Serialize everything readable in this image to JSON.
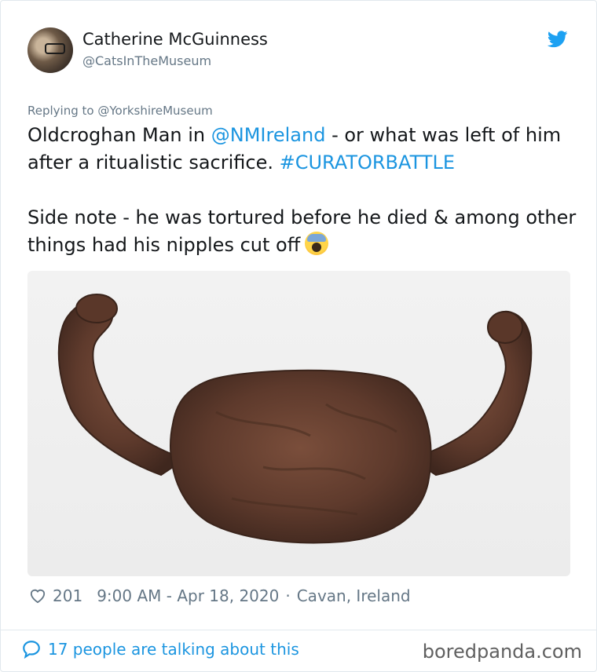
{
  "user": {
    "display_name": "Catherine McGuinness",
    "handle": "@CatsInTheMuseum"
  },
  "reply": {
    "prefix": "Replying to ",
    "target": "@YorkshireMuseum"
  },
  "tweet": {
    "line1_a": "Oldcroghan Man in ",
    "mention": "@NMIreland",
    "line1_b": " - or what was left of him after a ritualistic sacrifice. ",
    "hashtag": "#CURATORBATTLE",
    "line2": "Side note - he was tortured before he died & among other things had his nipples cut off"
  },
  "icons": {
    "bird": "twitter-bird-icon",
    "emoji": "screaming-face-emoji",
    "heart": "heart-icon",
    "bubble": "reply-bubble-icon"
  },
  "meta": {
    "likes": "201",
    "time": "9:00 AM - Apr 18, 2020",
    "separator": "·",
    "location": "Cavan, Ireland"
  },
  "footer": {
    "talking": "17 people are talking about this",
    "watermark": "boredpanda.com"
  },
  "colors": {
    "link": "#1b95e0",
    "muted": "#657786",
    "text": "#14171a",
    "border": "#e1e8ed"
  }
}
